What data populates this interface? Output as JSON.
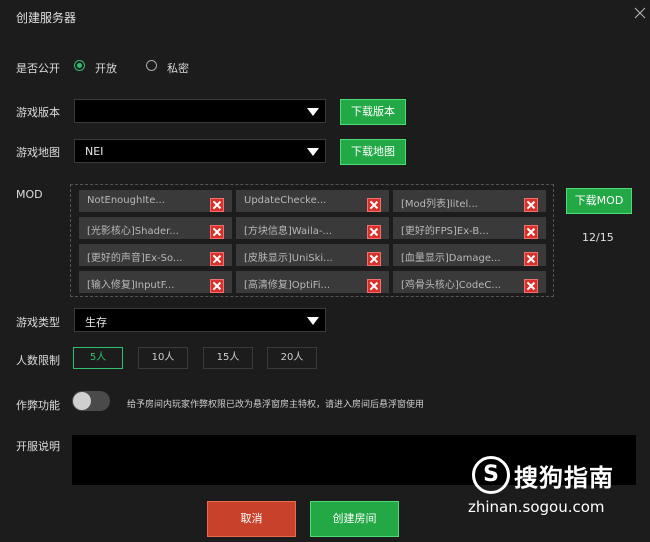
{
  "dialog": {
    "title": "创建服务器"
  },
  "visibility": {
    "label": "是否公开",
    "options": [
      "开放",
      "私密"
    ],
    "selected": 0
  },
  "version": {
    "label": "游戏版本",
    "value": "",
    "download_label": "下载版本"
  },
  "map": {
    "label": "游戏地图",
    "value": "NEI",
    "download_label": "下载地图"
  },
  "mods": {
    "label": "MOD",
    "items": [
      "NotEnoughIte...",
      "UpdateChecke...",
      "[Mod列表]litel...",
      "[光影核心]Shader...",
      "[方块信息]Waila-...",
      "[更好的FPS]Ex-B...",
      "[更好的声音]Ex-So...",
      "[皮肤显示]UniSki...",
      "[血量显示]Damage...",
      "[输入修复]InputF...",
      "[高清修复]OptiFi...",
      "[鸡骨头核心]CodeC..."
    ],
    "download_label": "下载MOD",
    "count": "12/15"
  },
  "game_type": {
    "label": "游戏类型",
    "value": "生存"
  },
  "players": {
    "label": "人数限制",
    "options": [
      "5人",
      "10人",
      "15人",
      "20人"
    ],
    "selected": 0
  },
  "cheat": {
    "label": "作弊功能",
    "enabled": false,
    "note": "给予房间内玩家作弊权限已改为悬浮窗房主特权，请进入房间后悬浮窗使用"
  },
  "description": {
    "label": "开服说明",
    "value": ""
  },
  "actions": {
    "cancel": "取消",
    "create": "创建房间"
  },
  "watermark": {
    "logo": "S",
    "name": "搜狗指南",
    "url": "zhinan.sogou.com"
  },
  "colors": {
    "accent": "#22a845",
    "danger": "#c8412a",
    "background": "#1c1c1c"
  }
}
